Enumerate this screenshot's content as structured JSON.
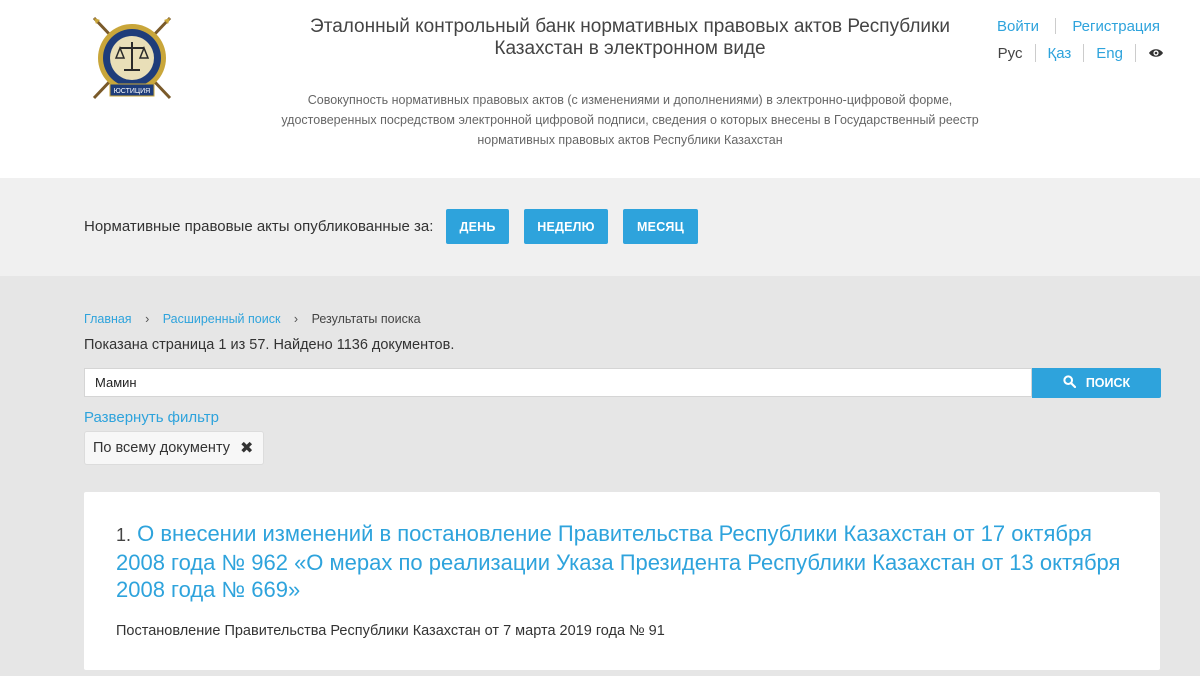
{
  "header": {
    "title": "Эталонный контрольный банк нормативных правовых актов Республики Казахстан в электронном виде",
    "description": "Совокупность нормативных правовых актов (с изменениями и дополнениями) в электронно-цифровой форме, удостоверенных посредством электронной цифровой подписи, сведения о которых внесены в Государственный реестр нормативных правовых актов Республики Казахстан",
    "logo_text": "ЮСТИЦИЯ",
    "login_label": "Войти",
    "register_label": "Регистрация",
    "languages": [
      "Рус",
      "Қаз",
      "Eng"
    ],
    "active_language": "Рус",
    "accessibility_icon": "eye-icon"
  },
  "period_bar": {
    "label": "Нормативные правовые акты опубликованные за:",
    "buttons": [
      "ДЕНЬ",
      "НЕДЕЛЮ",
      "МЕСЯЦ"
    ]
  },
  "breadcrumb": {
    "items": [
      "Главная",
      "Расширенный поиск",
      "Результаты поиска"
    ]
  },
  "search": {
    "page_info": "Показана страница 1 из 57. Найдено 1136 документов.",
    "query": "Мамин",
    "button_label": "ПОИСК",
    "button_icon": "search-icon",
    "expand_filter": "Развернуть фильтр",
    "filter_chip": "По всему документу"
  },
  "results": [
    {
      "number": "1.",
      "title": "О внесении изменений в постановление Правительства Республики Казахстан от 17 октября 2008 года № 962 «О мерах по реализации Указа Президента Республики Казахстан от 13 октября 2008 года № 669»",
      "subtitle": "Постановление Правительства Республики Казахстан от 7 марта 2019 года № 91"
    }
  ],
  "colors": {
    "accent": "#2ea3dc",
    "page_bg": "#e6e6e6",
    "bar_bg": "#f0f0f0"
  }
}
